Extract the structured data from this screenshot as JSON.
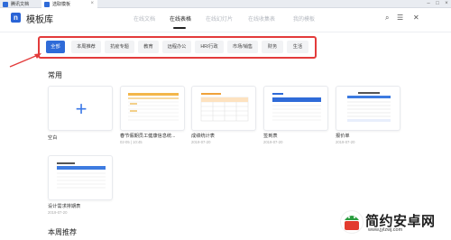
{
  "window": {
    "tabs": [
      {
        "label": "腾讯文档"
      },
      {
        "label": "选取模板"
      }
    ]
  },
  "header": {
    "title": "模板库",
    "nav": [
      "在线文档",
      "在线表格",
      "在线幻灯片",
      "在线收集表",
      "我的模板"
    ],
    "active_nav": "在线表格"
  },
  "categories": {
    "items": [
      "全部",
      "本周推荐",
      "抗疫专题",
      "教育",
      "远程办公",
      "HR/行政",
      "市场/销售",
      "财务",
      "生活"
    ],
    "active": "全部"
  },
  "sections": {
    "common": {
      "title": "常用",
      "cards": [
        {
          "name": "空白",
          "date": ""
        },
        {
          "name": "春节假期员工健康信息统...",
          "date": "02-05 | 10:45"
        },
        {
          "name": "成绩统计表",
          "date": "2019-07-20"
        },
        {
          "name": "签到表",
          "date": "2019-07-20"
        },
        {
          "name": "报价单",
          "date": "2019-07-20"
        },
        {
          "name": "设计需求排期表",
          "date": "2019-07-20"
        }
      ]
    },
    "weekly": {
      "title": "本周推荐"
    }
  },
  "watermark": {
    "text": "简约安卓网",
    "url": "www.jylzwj.com"
  },
  "colors": {
    "accent": "#2f6bd8",
    "highlight_border": "#e33b3b",
    "title_text": "#222222"
  }
}
